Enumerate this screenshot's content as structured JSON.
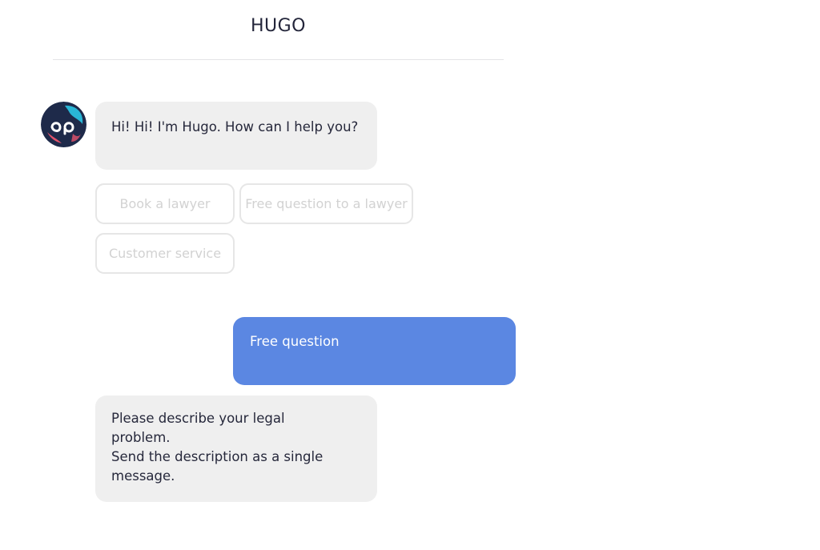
{
  "header": {
    "title": "HUGO"
  },
  "bot": {
    "avatar_icon": "hugo-logo-icon"
  },
  "messages": {
    "greeting": "Hi! Hi! I'm Hugo. How can I help you?",
    "user_reply": "Free question",
    "describe_prompt": "Please describe your legal\nproblem.\nSend the description as a single\nmessage."
  },
  "quick_replies": [
    {
      "label": "Book a lawyer"
    },
    {
      "label": "Free question to a lawyer"
    },
    {
      "label": "Customer service"
    }
  ],
  "colors": {
    "user_bubble": "#5b87e2",
    "bot_bubble": "#efefef",
    "avatar_bg": "#1e2a4a",
    "avatar_accent_teal": "#29b6d6",
    "avatar_accent_pink": "#e2536b"
  }
}
